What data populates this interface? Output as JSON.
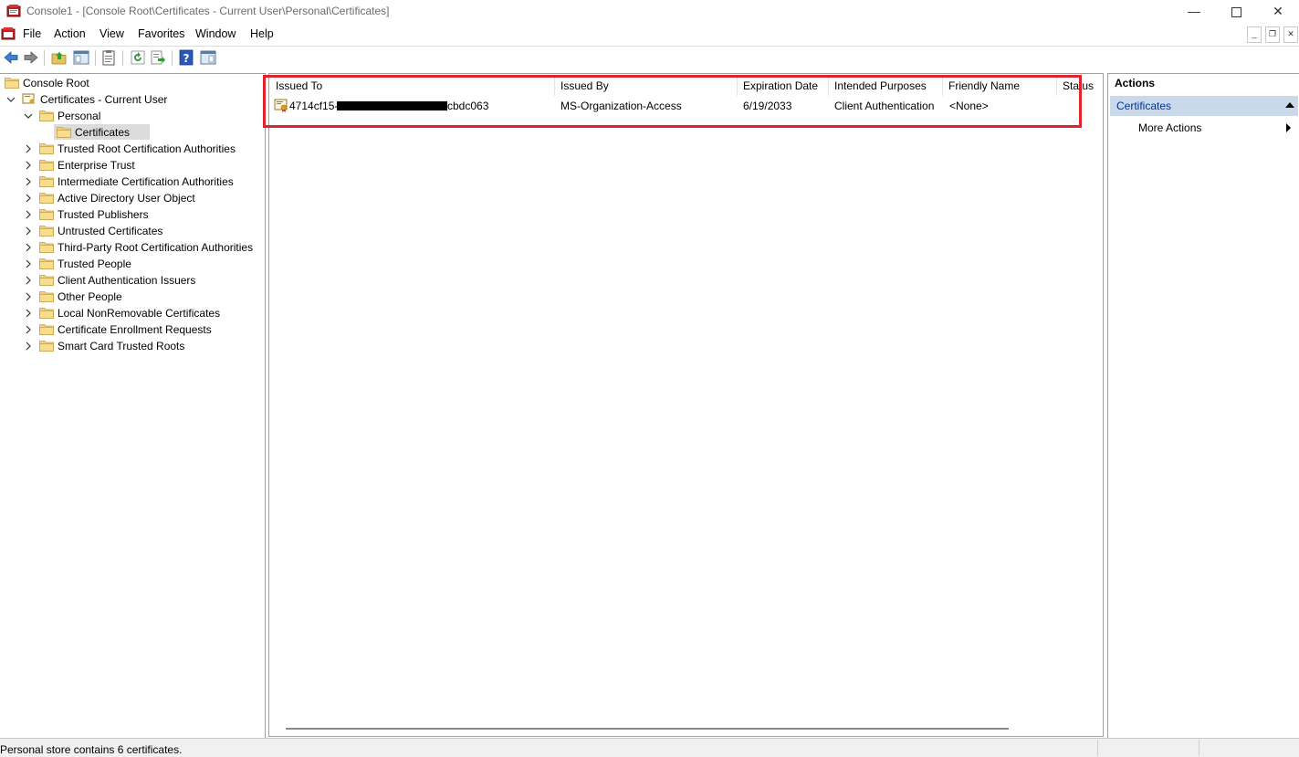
{
  "window": {
    "title": "Console1 - [Console Root\\Certificates - Current User\\Personal\\Certificates]"
  },
  "menu": {
    "items": [
      "File",
      "Action",
      "View",
      "Favorites",
      "Window",
      "Help"
    ]
  },
  "toolbar": {
    "icons": [
      "back-icon",
      "forward-icon",
      "up-folder-icon",
      "show-hide-tree-icon",
      "export-list-icon",
      "refresh-icon",
      "export-icon",
      "help-icon",
      "show-hide-action-pane-icon"
    ]
  },
  "tree": {
    "items": [
      {
        "label": "Console Root",
        "level": 0,
        "chevron": "none"
      },
      {
        "label": "Certificates - Current User",
        "level": 1,
        "chevron": "expanded"
      },
      {
        "label": "Personal",
        "level": 2,
        "chevron": "expanded"
      },
      {
        "label": "Certificates",
        "level": 3,
        "chevron": "none",
        "selected": true
      },
      {
        "label": "Trusted Root Certification Authorities",
        "level": 2,
        "chevron": "collapsed"
      },
      {
        "label": "Enterprise Trust",
        "level": 2,
        "chevron": "collapsed"
      },
      {
        "label": "Intermediate Certification Authorities",
        "level": 2,
        "chevron": "collapsed"
      },
      {
        "label": "Active Directory User Object",
        "level": 2,
        "chevron": "collapsed"
      },
      {
        "label": "Trusted Publishers",
        "level": 2,
        "chevron": "collapsed"
      },
      {
        "label": "Untrusted Certificates",
        "level": 2,
        "chevron": "collapsed"
      },
      {
        "label": "Third-Party Root Certification Authorities",
        "level": 2,
        "chevron": "collapsed"
      },
      {
        "label": "Trusted People",
        "level": 2,
        "chevron": "collapsed"
      },
      {
        "label": "Client Authentication Issuers",
        "level": 2,
        "chevron": "collapsed"
      },
      {
        "label": "Other People",
        "level": 2,
        "chevron": "collapsed"
      },
      {
        "label": "Local NonRemovable Certificates",
        "level": 2,
        "chevron": "collapsed"
      },
      {
        "label": "Certificate Enrollment Requests",
        "level": 2,
        "chevron": "collapsed"
      },
      {
        "label": "Smart Card Trusted Roots",
        "level": 2,
        "chevron": "collapsed"
      }
    ]
  },
  "list": {
    "columns": [
      "Issued To",
      "Issued By",
      "Expiration Date",
      "Intended Purposes",
      "Friendly Name",
      "Status"
    ],
    "rows": [
      {
        "issued_to_prefix": "4714cf15-",
        "issued_to_suffix": "cbdc063",
        "issued_by": "MS-Organization-Access",
        "expiration_date": "6/19/2033",
        "intended_purposes": "Client Authentication",
        "friendly_name": "<None>",
        "status": ""
      }
    ],
    "highlight_color": "#e0242f"
  },
  "actions": {
    "title": "Actions",
    "section": "Certificates",
    "items": [
      "More Actions"
    ]
  },
  "status": {
    "text": "Personal store contains 6 certificates."
  }
}
